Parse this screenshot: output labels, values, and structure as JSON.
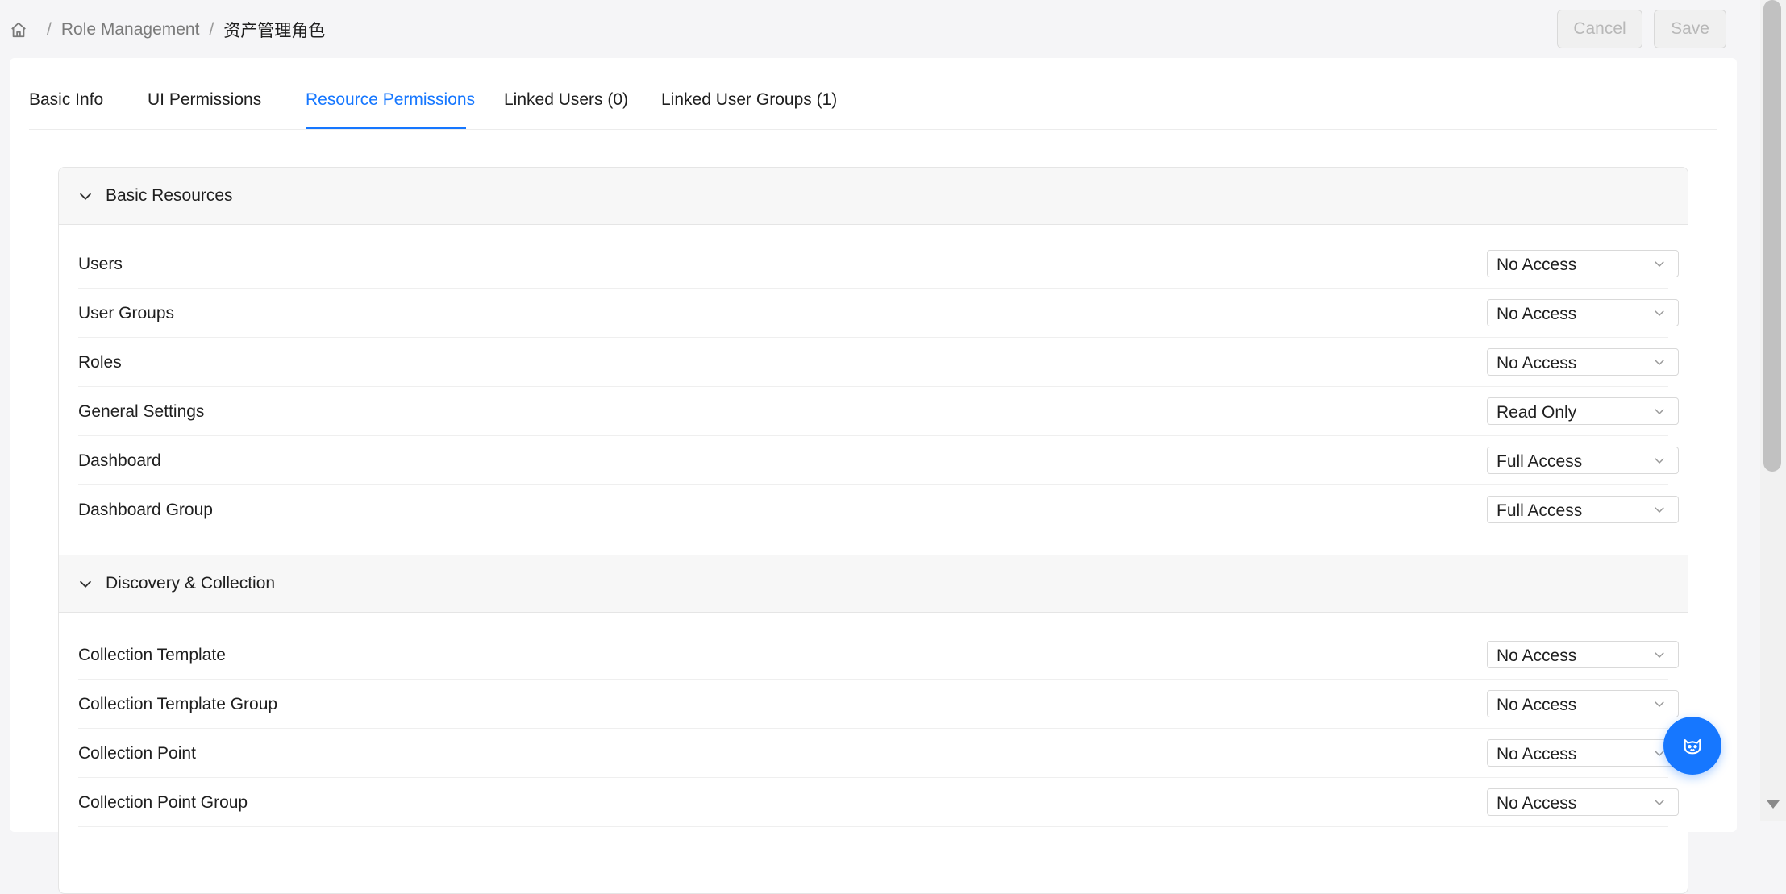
{
  "breadcrumb": {
    "items": [
      "Role Management",
      "资产管理角色"
    ],
    "separator": "/"
  },
  "actions": {
    "cancel_label": "Cancel",
    "save_label": "Save"
  },
  "tabs": [
    {
      "label": "Basic Info",
      "active": false
    },
    {
      "label": "UI Permissions",
      "active": false
    },
    {
      "label": "Resource Permissions",
      "active": true
    },
    {
      "label": "Linked Users (0)",
      "active": false
    },
    {
      "label": "Linked User Groups (1)",
      "active": false
    }
  ],
  "sections": [
    {
      "title": "Basic Resources",
      "expanded": true,
      "rows": [
        {
          "label": "Users",
          "value": "No Access"
        },
        {
          "label": "User Groups",
          "value": "No Access"
        },
        {
          "label": "Roles",
          "value": "No Access"
        },
        {
          "label": "General Settings",
          "value": "Read Only"
        },
        {
          "label": "Dashboard",
          "value": "Full Access"
        },
        {
          "label": "Dashboard Group",
          "value": "Full Access"
        }
      ]
    },
    {
      "title": "Discovery & Collection",
      "expanded": true,
      "rows": [
        {
          "label": "Collection Template",
          "value": "No Access"
        },
        {
          "label": "Collection Template Group",
          "value": "No Access"
        },
        {
          "label": "Collection Point",
          "value": "No Access"
        },
        {
          "label": "Collection Point Group",
          "value": "No Access"
        }
      ]
    }
  ],
  "colors": {
    "accent": "#1677ff",
    "background": "#f5f5f7",
    "section_header": "#f7f7f7"
  },
  "icons": {
    "home": "home-icon",
    "collapse": "chevron-down-icon",
    "select": "chevron-down-icon",
    "assistant": "robot-icon"
  }
}
